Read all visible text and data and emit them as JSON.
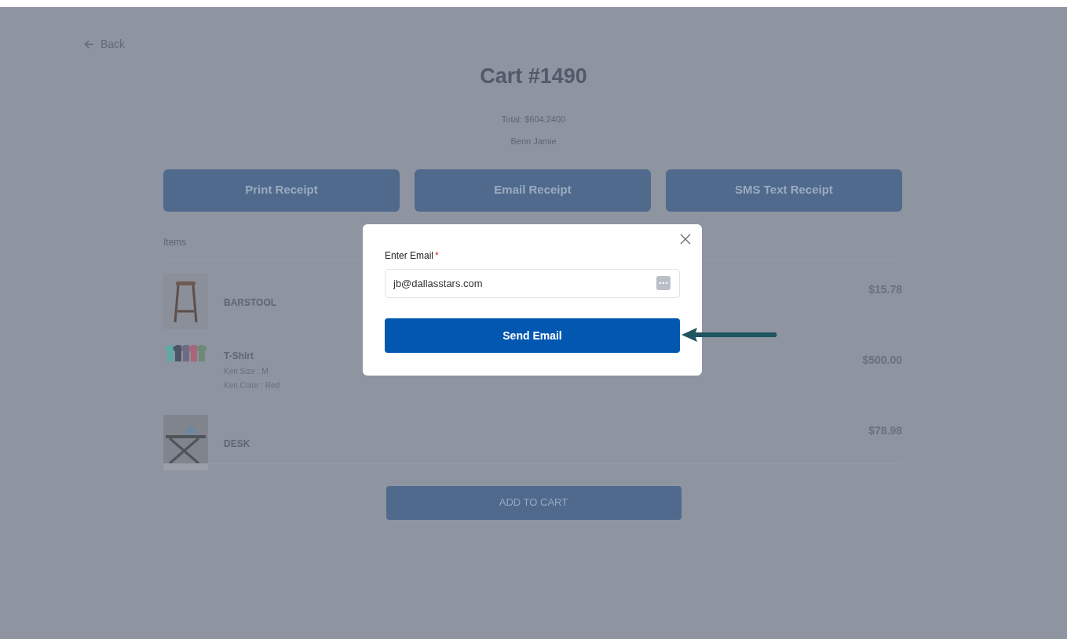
{
  "back_link": {
    "label": "Back"
  },
  "cart": {
    "title": "Cart #1490",
    "total": "Total: $604.2400",
    "customer": "Benn Jamie"
  },
  "receipt_buttons": [
    "Print Receipt",
    "Email Receipt",
    "SMS Text Receipt"
  ],
  "items_heading": "Items",
  "items": [
    {
      "name": "BARSTOOL",
      "price": "$15.78"
    },
    {
      "name": "T-Shirt",
      "attributes": [
        "Ken Size : M",
        "Ken Color : Red"
      ],
      "price": "$500.00"
    },
    {
      "name": "DESK",
      "price": "$78.98"
    }
  ],
  "add_to_cart_button": "ADD TO CART",
  "email_dialog": {
    "label": "Enter Email",
    "required_mark": "*",
    "value": "jb@dallasstars.com",
    "submit_button": "Send Email"
  }
}
